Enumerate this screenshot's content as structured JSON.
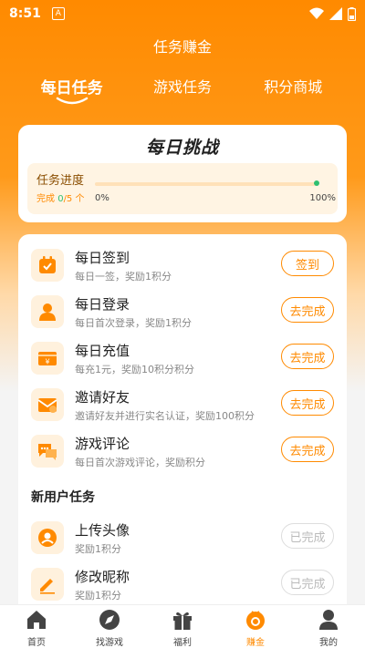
{
  "status": {
    "time": "8:51",
    "notif": "A"
  },
  "header": {
    "title": "任务赚金"
  },
  "tabs": [
    {
      "label": "每日任务",
      "active": true
    },
    {
      "label": "游戏任务",
      "active": false
    },
    {
      "label": "积分商城",
      "active": false
    }
  ],
  "challenge": {
    "title": "每日挑战",
    "progress_label": "任务进度",
    "done_prefix": "完成 ",
    "done_count": "0",
    "total_suffix": "/5 个",
    "min_label": "0%",
    "max_label": "100%",
    "progress": 0
  },
  "daily_tasks": [
    {
      "name": "每日签到",
      "desc": "每日一签，奖励1积分",
      "button": "签到",
      "icon": "calendar-check-icon",
      "completed": false
    },
    {
      "name": "每日登录",
      "desc": "每日首次登录，奖励1积分",
      "button": "去完成",
      "icon": "user-icon",
      "completed": false
    },
    {
      "name": "每日充值",
      "desc": "每充1元，奖励10积分积分",
      "button": "去完成",
      "icon": "yen-card-icon",
      "completed": false
    },
    {
      "name": "邀请好友",
      "desc": "邀请好友并进行实名认证，奖励100积分",
      "button": "去完成",
      "icon": "invite-mail-icon",
      "completed": false
    },
    {
      "name": "游戏评论",
      "desc": "每日首次游戏评论，奖励积分",
      "button": "去完成",
      "icon": "comment-icon",
      "completed": false
    }
  ],
  "new_user_section": "新用户任务",
  "new_user_tasks": [
    {
      "name": "上传头像",
      "desc": "奖励1积分",
      "button": "已完成",
      "icon": "avatar-upload-icon",
      "completed": true
    },
    {
      "name": "修改昵称",
      "desc": "奖励1积分",
      "button": "已完成",
      "icon": "edit-pencil-icon",
      "completed": true
    }
  ],
  "nav": [
    {
      "label": "首页",
      "icon": "home-icon",
      "active": false
    },
    {
      "label": "找游戏",
      "icon": "compass-icon",
      "active": false
    },
    {
      "label": "福利",
      "icon": "gift-icon",
      "active": false
    },
    {
      "label": "赚金",
      "icon": "coin-bag-icon",
      "active": true
    },
    {
      "label": "我的",
      "icon": "profile-icon",
      "active": false
    }
  ],
  "colors": {
    "accent": "#ff8a00",
    "success": "#2fbf71"
  }
}
